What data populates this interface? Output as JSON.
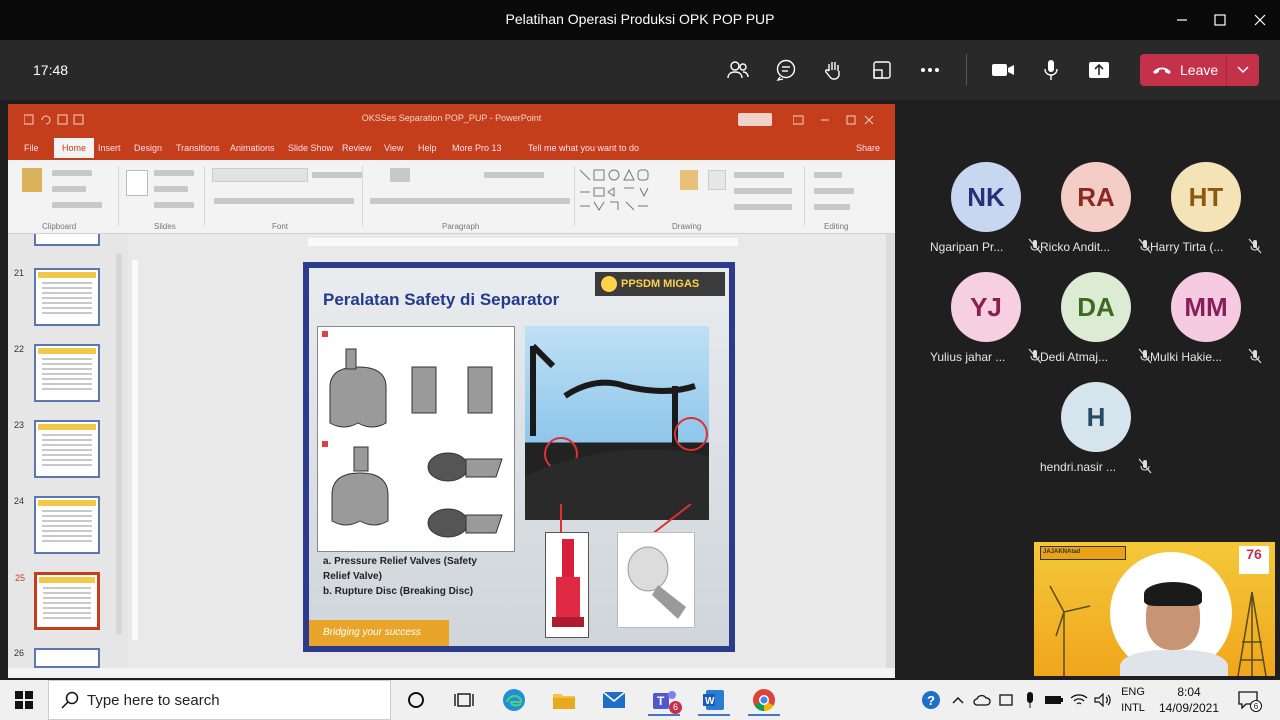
{
  "window": {
    "title": "Pelatihan Operasi Produksi OPK POP PUP"
  },
  "meeting": {
    "elapsed": "17:48",
    "leave_label": "Leave"
  },
  "shared_screen": {
    "ppt_title": "OKSSes Separation POP_PUP - PowerPoint",
    "tabs": [
      "File",
      "Home",
      "Insert",
      "Design",
      "Transitions",
      "Animations",
      "Slide Show",
      "Review",
      "View",
      "Help",
      "More Pro 13",
      "Tell me what you want to do"
    ],
    "share_label": "Share",
    "ribbon_groups": [
      "Clipboard",
      "Slides",
      "Font",
      "Paragraph",
      "Drawing",
      "Editing"
    ],
    "thumbnails": [
      {
        "num": "21",
        "selected": false
      },
      {
        "num": "22",
        "selected": false
      },
      {
        "num": "23",
        "selected": false
      },
      {
        "num": "24",
        "selected": false
      },
      {
        "num": "25",
        "selected": true
      },
      {
        "num": "26",
        "selected": false
      }
    ],
    "slide": {
      "title": "Peralatan Safety di Separator",
      "logo_text": "PPSDM MIGAS",
      "caption_a": "a.  Pressure Relief Valves (Safety",
      "caption_a2": "     Relief Valve)",
      "caption_b": "b.  Rupture Disc (Breaking Disc)",
      "footer_text": "Bridging your success"
    }
  },
  "participants": [
    {
      "initials": "NK",
      "name": "Ngaripan Pr...",
      "bg": "#c8d7f0",
      "fg": "#23307a"
    },
    {
      "initials": "RA",
      "name": "Ricko Andit...",
      "bg": "#f4cdc6",
      "fg": "#8a2a1e"
    },
    {
      "initials": "HT",
      "name": "Harry Tirta (...",
      "bg": "#f5e3b8",
      "fg": "#8a5a10"
    },
    {
      "initials": "YJ",
      "name": "Yulius jahar ...",
      "bg": "#f6cfe0",
      "fg": "#8a1e4e"
    },
    {
      "initials": "DA",
      "name": "Dedi Atmaj...",
      "bg": "#dcebd4",
      "fg": "#3c6a20"
    },
    {
      "initials": "MM",
      "name": "Mulki Hakie...",
      "bg": "#f6cbe2",
      "fg": "#8a1e5a"
    },
    {
      "initials": "H",
      "name": "hendri.nasir ...",
      "bg": "#d6e4ee",
      "fg": "#274a64"
    }
  ],
  "self_video": {
    "banner_text": "JAJAKNAtad",
    "badge_text": "76"
  },
  "taskbar": {
    "search_placeholder": "Type here to search",
    "teams_badge": "6",
    "lang_top": "ENG",
    "lang_bottom": "INTL",
    "time": "8:04",
    "date": "14/09/2021",
    "notif_count": "6"
  }
}
